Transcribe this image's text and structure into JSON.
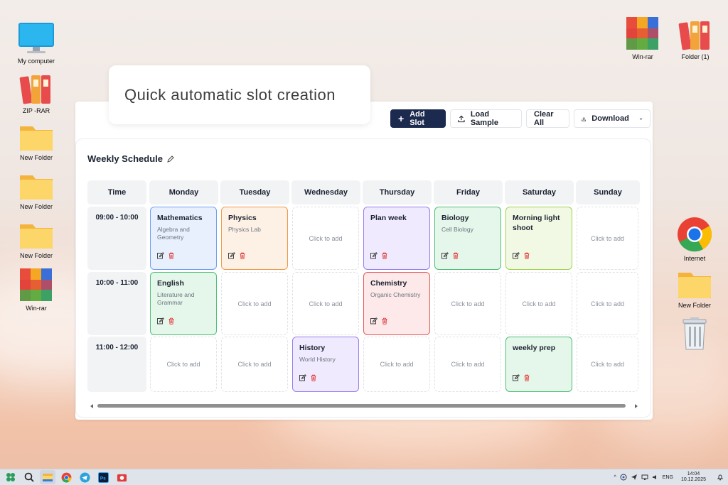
{
  "desktop": {
    "left_icons": [
      {
        "label": "My computer",
        "icon": "monitor-icon"
      },
      {
        "label": "ZIP -RAR",
        "icon": "binders-icon"
      },
      {
        "label": "New Folder",
        "icon": "folder-icon"
      },
      {
        "label": "New Folder",
        "icon": "folder-icon"
      },
      {
        "label": "New Folder",
        "icon": "folder-icon"
      },
      {
        "label": "Win-rar",
        "icon": "winrar-icon"
      }
    ],
    "right_icons": [
      {
        "label": "Win-rar",
        "icon": "winrar-icon"
      },
      {
        "label": "Folder (1)",
        "icon": "binders-icon"
      },
      {
        "label": "Internet",
        "icon": "chrome-icon"
      },
      {
        "label": "New Folder",
        "icon": "folder-icon"
      },
      {
        "label": "",
        "icon": "trash-icon"
      }
    ]
  },
  "callout": {
    "text": "Quick automatic slot creation"
  },
  "toolbar": {
    "add_slot": "Add Slot",
    "load_sample": "Load Sample",
    "clear_all": "Clear All",
    "download": "Download"
  },
  "schedule": {
    "title": "Weekly Schedule",
    "time_header": "Time",
    "days": [
      "Monday",
      "Tuesday",
      "Wednesday",
      "Thursday",
      "Friday",
      "Saturday",
      "Sunday"
    ],
    "times": [
      "09:00 - 10:00",
      "10:00 - 11:00",
      "11:00 - 12:00"
    ],
    "empty_label": "Click to add",
    "slots": [
      {
        "day": 0,
        "row": 0,
        "title": "Mathematics",
        "subtitle": "Algebra and Geometry",
        "color": "#6e9ef0",
        "bg": "#e8f0fd"
      },
      {
        "day": 1,
        "row": 0,
        "title": "Physics",
        "subtitle": "Physics Lab",
        "color": "#ef9a4c",
        "bg": "#fdf0e4"
      },
      {
        "day": 3,
        "row": 0,
        "title": "Plan week",
        "subtitle": "",
        "color": "#9a7cf0",
        "bg": "#efeafd"
      },
      {
        "day": 4,
        "row": 0,
        "title": "Biology",
        "subtitle": "Cell Biology",
        "color": "#4fbf76",
        "bg": "#e5f6ea"
      },
      {
        "day": 5,
        "row": 0,
        "title": "Morning light shoot",
        "subtitle": "",
        "color": "#9fd24c",
        "bg": "#f1f9e4"
      },
      {
        "day": 0,
        "row": 1,
        "title": "English",
        "subtitle": "Literature and Grammar",
        "color": "#4fbf76",
        "bg": "#e5f6ea"
      },
      {
        "day": 3,
        "row": 1,
        "title": "Chemistry",
        "subtitle": "Organic Chemistry",
        "color": "#e25a5a",
        "bg": "#fde9e9"
      },
      {
        "day": 2,
        "row": 2,
        "title": "History",
        "subtitle": "World History",
        "color": "#9a7cf0",
        "bg": "#efeafd"
      },
      {
        "day": 5,
        "row": 2,
        "title": "weekly prep",
        "subtitle": "",
        "color": "#4fbf76",
        "bg": "#e5f6ea"
      }
    ]
  },
  "taskbar": {
    "lang": "ENG",
    "time": "14:04",
    "date": "10.12.2025"
  }
}
